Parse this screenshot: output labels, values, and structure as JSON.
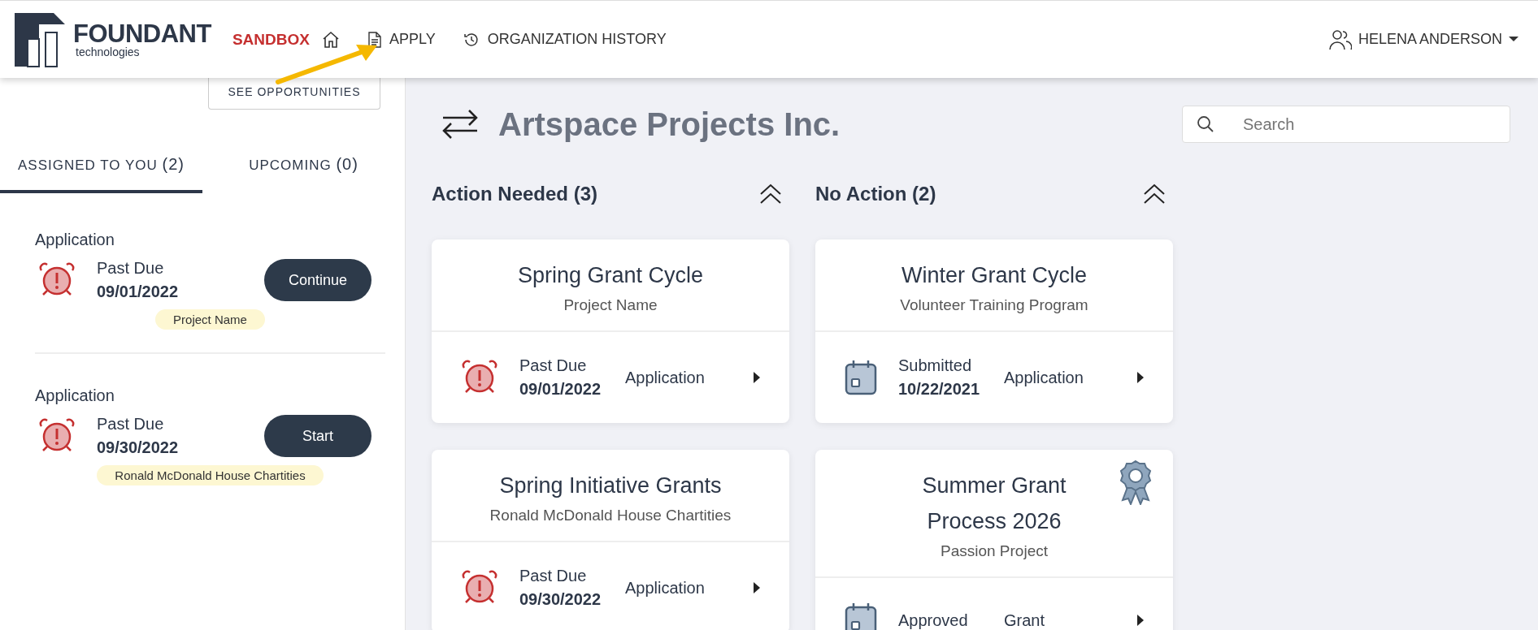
{
  "header": {
    "logo": {
      "name": "FOUNDANT",
      "tagline": "technologies"
    },
    "mode_label": "SANDBOX",
    "nav": [
      {
        "kind": "home"
      },
      {
        "kind": "apply",
        "label": "APPLY"
      },
      {
        "kind": "history",
        "label": "ORGANIZATION HISTORY"
      }
    ],
    "user": "HELENA ANDERSON"
  },
  "sidebar": {
    "see_opportunities": "SEE OPPORTUNITIES",
    "tabs": [
      {
        "label": "ASSIGNED TO YOU",
        "count": "(2)",
        "selected": true
      },
      {
        "label": "UPCOMING",
        "count": "(0)",
        "selected": false
      }
    ],
    "tasks": [
      {
        "type": "Application",
        "status": "Past Due",
        "date": "09/01/2022",
        "action": "Continue",
        "tag": "Project Name"
      },
      {
        "type": "Application",
        "status": "Past Due",
        "date": "09/30/2022",
        "action": "Start",
        "tag": "Ronald McDonald House Chartities"
      }
    ]
  },
  "main": {
    "organization": "Artspace Projects Inc.",
    "search": {
      "placeholder": "Search"
    },
    "columns": [
      {
        "title": "Action Needed (3)",
        "cards": [
          {
            "title": [
              "Spring Grant Cycle"
            ],
            "subtitle": "Project Name",
            "kind": "alarm",
            "status": "Past Due",
            "date": "09/01/2022",
            "type": "Application",
            "award": false
          },
          {
            "title": [
              "Spring Initiative Grants"
            ],
            "subtitle": "Ronald McDonald House Chartities",
            "kind": "alarm",
            "status": "Past Due",
            "date": "09/30/2022",
            "type": "Application",
            "award": false
          }
        ]
      },
      {
        "title": "No Action (2)",
        "cards": [
          {
            "title": [
              "Winter Grant Cycle"
            ],
            "subtitle": "Volunteer Training Program",
            "kind": "calendar",
            "status": "Submitted",
            "date": "10/22/2021",
            "type": "Application",
            "award": false
          },
          {
            "title": [
              "Summer Grant",
              "Process 2026"
            ],
            "subtitle": "Passion Project",
            "kind": "calendar",
            "status": "Approved",
            "type": "Grant",
            "award": true
          }
        ]
      }
    ]
  }
}
